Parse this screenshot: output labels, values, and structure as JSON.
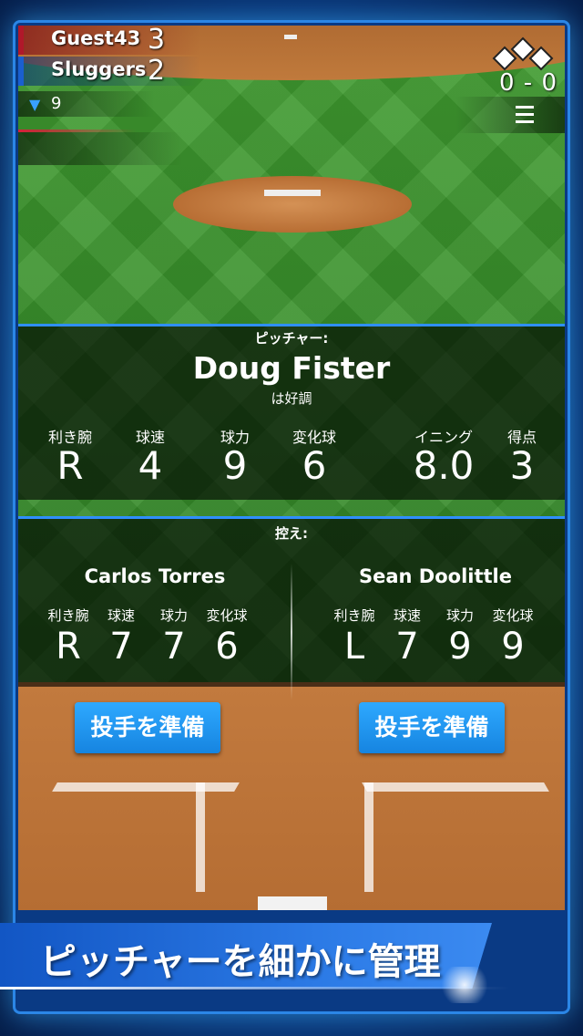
{
  "scoreboard": {
    "home_team": {
      "name": "Guest43",
      "score": "3",
      "color": "#b0182a"
    },
    "away_team": {
      "name": "Sluggers",
      "score": "2",
      "color": "#1a5fd0"
    },
    "inning_indicator": "▼",
    "inning": "9",
    "count": "0 - 0"
  },
  "pitcher": {
    "section_label": "ピッチャー:",
    "name": "Doug Fister",
    "condition": "は好調",
    "stats": [
      {
        "label": "利き腕",
        "value": "R"
      },
      {
        "label": "球速",
        "value": "4"
      },
      {
        "label": "球力",
        "value": "9"
      },
      {
        "label": "変化球",
        "value": "6"
      },
      {
        "label": "イニング",
        "value": "8.0"
      },
      {
        "label": "得点",
        "value": "3"
      }
    ]
  },
  "bullpen": {
    "section_label": "控え:",
    "relievers": [
      {
        "name": "Carlos Torres",
        "stats": [
          {
            "label": "利き腕",
            "value": "R"
          },
          {
            "label": "球速",
            "value": "7"
          },
          {
            "label": "球力",
            "value": "7"
          },
          {
            "label": "変化球",
            "value": "6"
          }
        ],
        "button_label": "投手を準備"
      },
      {
        "name": "Sean Doolittle",
        "stats": [
          {
            "label": "利き腕",
            "value": "L"
          },
          {
            "label": "球速",
            "value": "7"
          },
          {
            "label": "球力",
            "value": "9"
          },
          {
            "label": "変化球",
            "value": "9"
          }
        ],
        "button_label": "投手を準備"
      }
    ]
  },
  "icons": {
    "bases": "bases-diamond-icon",
    "menu": "menu-icon"
  },
  "banner": {
    "text": "ピッチャーを細かに管理"
  }
}
